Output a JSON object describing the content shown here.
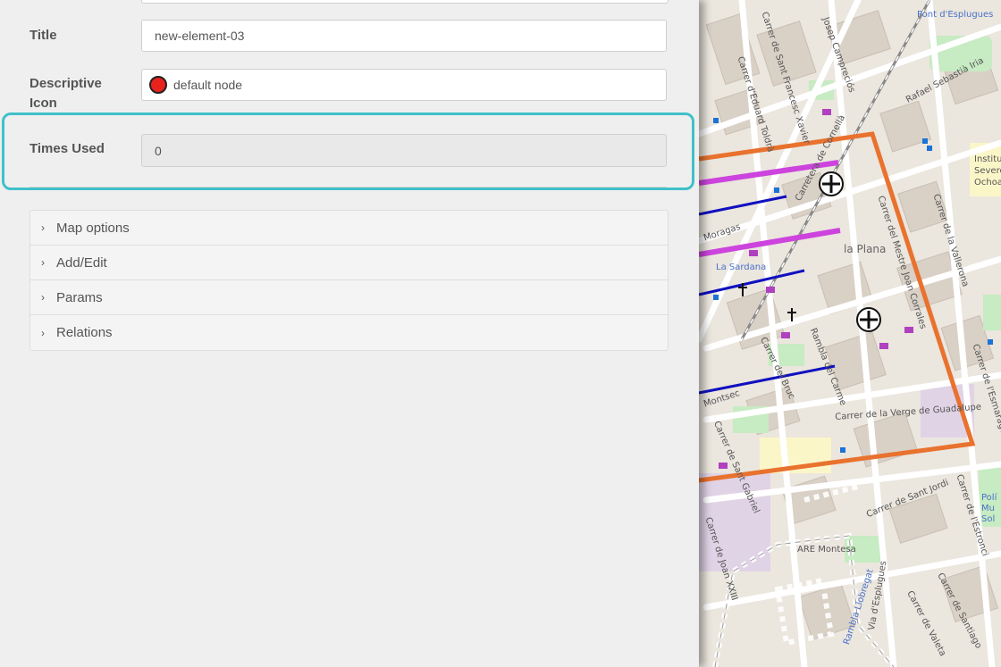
{
  "form": {
    "title_label": "Title",
    "title_value": "new-element-03",
    "icon_label_line1": "Descriptive",
    "icon_label_line2": "Icon",
    "icon_value": "default node",
    "icon_color": "#e8231b",
    "times_used_label": "Times Used",
    "times_used_value": "0"
  },
  "accordion": [
    {
      "label": "Map options",
      "icon": "chevron-right-icon"
    },
    {
      "label": "Add/Edit",
      "icon": "chevron-right-icon"
    },
    {
      "label": "Params",
      "icon": "chevron-right-icon"
    },
    {
      "label": "Relations",
      "icon": "chevron-right-icon"
    }
  ],
  "map": {
    "labels": [
      "Pont d'Esplugues",
      "Josep Campreciós",
      "Carrer de Sant Francesc Xavier",
      "Carrer d'Eduard Toldrà",
      "Rafael Sebastià Iria",
      "Institut Severo Ochoa",
      "Carretera de Cornellà",
      "Carrer del Mestre Joan Corrales",
      "la Plana",
      "La Sardana",
      "Carrer del Bruc",
      "Rambla del Carme",
      "Carrer de la Vallerona",
      "Carrer de l'Esmaragda",
      "Carrer de la Verge de Guadalupe",
      "Carrer de Sant Gabriel",
      "Carrer de Sant Jordi",
      "Carrer de Joan XXIII",
      "ARE Montesa",
      "Carrer de Valeta",
      "Carrer de Santiago",
      "Carrer de l'Estronci",
      "Rambla Llobregat",
      "Via d'Esplugues",
      "Montsec",
      "Moragas",
      "Polí Mu Sol"
    ],
    "colors": {
      "area_outline": "#e8722e",
      "magenta_line": "#cc44dd",
      "blue_line": "#1010c0",
      "highlight": "#40c0c8"
    }
  }
}
